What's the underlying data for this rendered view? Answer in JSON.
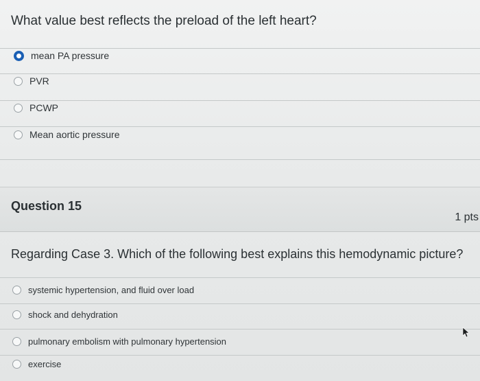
{
  "question14": {
    "text": "What value best reflects the preload of the left heart?",
    "answers": [
      {
        "label": "mean PA pressure",
        "selected": true
      },
      {
        "label": "PVR",
        "selected": false
      },
      {
        "label": "PCWP",
        "selected": false
      },
      {
        "label": "Mean aortic pressure",
        "selected": false
      }
    ]
  },
  "question15": {
    "title": "Question 15",
    "points": "1 pts",
    "text": "Regarding Case 3. Which of the following best explains this hemodynamic picture?",
    "answers": [
      {
        "label": "systemic hypertension, and fluid over load",
        "selected": false
      },
      {
        "label": "shock and dehydration",
        "selected": false
      },
      {
        "label": "pulmonary embolism with pulmonary hypertension",
        "selected": false
      },
      {
        "label": "exercise",
        "selected": false
      }
    ]
  },
  "colors": {
    "selected_radio": "#1a5fb4",
    "text": "#2a3033"
  }
}
